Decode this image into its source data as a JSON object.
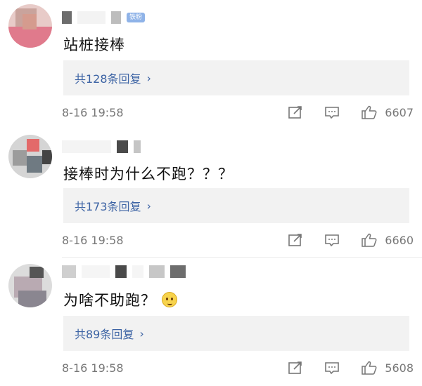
{
  "comments": [
    {
      "text": "站桩接棒",
      "badge": "铁粉",
      "replies_label": "共128条回复",
      "time": "8-16 19:58",
      "likes": "6607"
    },
    {
      "text": "接棒时为什么不跑？？？",
      "replies_label": "共173条回复",
      "time": "8-16 19:58",
      "likes": "6660"
    },
    {
      "text": "为啥不助跑？",
      "replies_label": "共89条回复",
      "time": "8-16 19:58",
      "likes": "5608"
    }
  ],
  "icons": {
    "replies_chevron": "chevron-right-icon",
    "share": "share-icon",
    "comment": "comment-icon",
    "like": "thumbs-up-icon",
    "emoji": "thinking-face-emoji"
  },
  "colors": {
    "link": "#3c63a4",
    "reply_box": "#f2f2f2",
    "meta_gray": "#777777",
    "badge": "#8fb3e8"
  }
}
